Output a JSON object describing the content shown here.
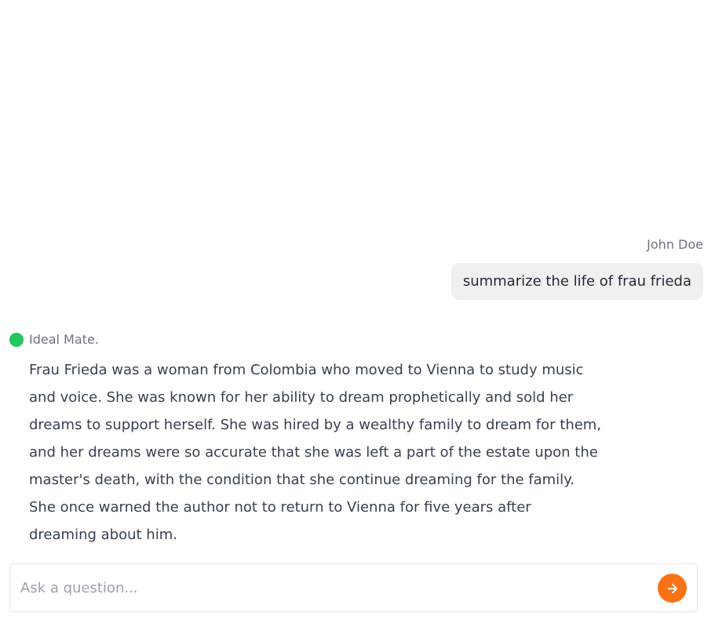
{
  "conversation": {
    "user_message": {
      "author": "John Doe",
      "text": "summarize the life of frau frieda"
    },
    "assistant_message": {
      "author": "Ideal Mate.",
      "status_color": "#22c55e",
      "text": "Frau Frieda was a woman from Colombia who moved to Vienna to study music and voice. She was known for her ability to dream prophetically and sold her dreams to support herself. She was hired by a wealthy family to dream for them, and her dreams were so accurate that she was left a part of the estate upon the master's death, with the condition that she continue dreaming for the family. She once warned the author not to return to Vienna for five years after dreaming about him."
    }
  },
  "composer": {
    "placeholder": "Ask a question...",
    "value": "",
    "send_icon": "arrow-right-icon",
    "accent_color": "#f97316"
  }
}
